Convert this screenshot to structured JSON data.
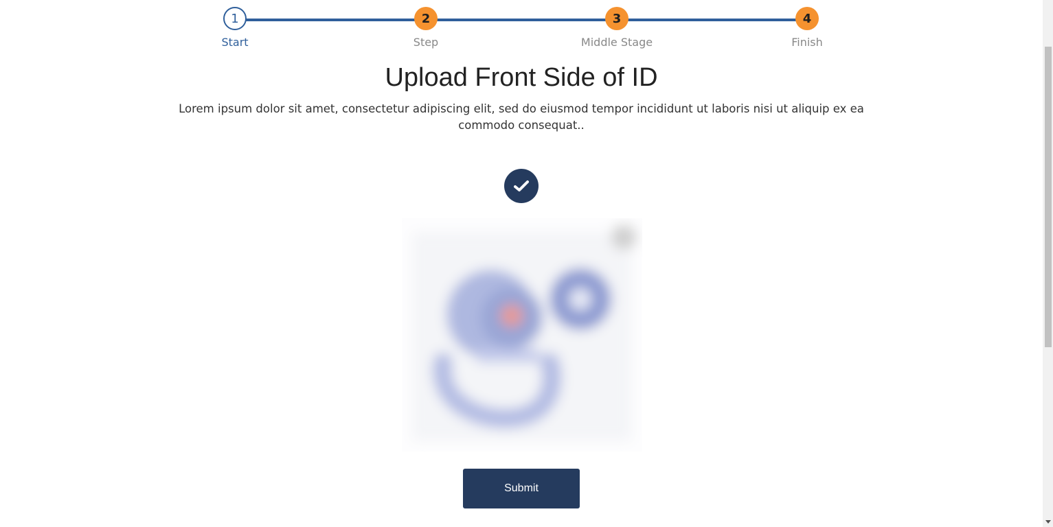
{
  "stepper": {
    "steps": [
      {
        "number": "1",
        "label": "Start",
        "state": "active"
      },
      {
        "number": "2",
        "label": "Step",
        "state": "pending"
      },
      {
        "number": "3",
        "label": "Middle Stage",
        "state": "pending"
      },
      {
        "number": "4",
        "label": "Finish",
        "state": "pending"
      }
    ],
    "colors": {
      "line": "#2f5f9b",
      "pending": "#f5922f",
      "active": "#2f5f9b"
    }
  },
  "heading": {
    "title": "Upload Front Side of ID",
    "description": "Lorem ipsum dolor sit amet, consectetur adipiscing elit, sed do eiusmod tempor incididunt ut laboris nisi ut aliquip ex ea commodo consequat.."
  },
  "upload": {
    "status_icon": "check-icon",
    "preview_icon": "blurred-uploaded-image"
  },
  "actions": {
    "submit_label": "Submit"
  },
  "colors": {
    "primary": "#253b5e",
    "accent": "#f5922f"
  }
}
